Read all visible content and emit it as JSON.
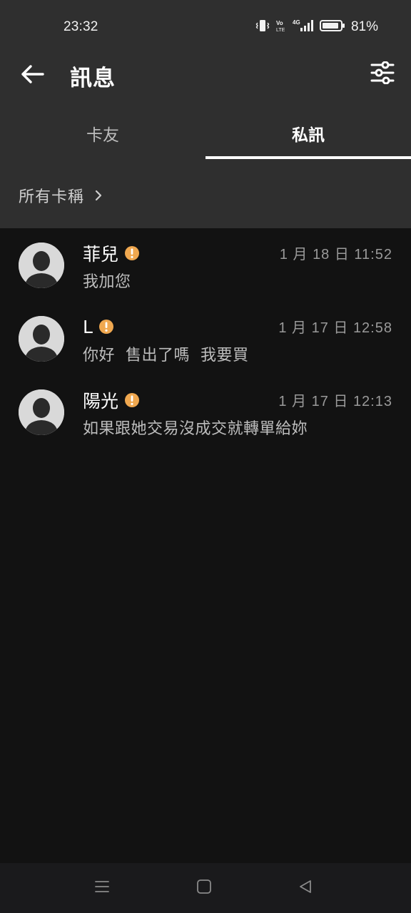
{
  "status_bar": {
    "time": "23:32",
    "battery_percent": "81%",
    "icons": [
      "vibrate-icon",
      "volte-icon",
      "4g-signal-icon",
      "battery-icon"
    ]
  },
  "app_bar": {
    "title": "訊息",
    "back_icon": "arrow-left-icon",
    "filter_icon": "sliders-icon"
  },
  "tabs": [
    {
      "label": "卡友",
      "selected": false
    },
    {
      "label": "私訊",
      "selected": true
    }
  ],
  "filter": {
    "label": "所有卡稱"
  },
  "conversations": [
    {
      "name": "菲兒",
      "time": "1 月 18 日 11:52",
      "message": "我加您",
      "badge": "warning-icon"
    },
    {
      "name": "L",
      "time": "1 月 17 日 12:58",
      "message": "你好  售出了嗎  我要買",
      "badge": "warning-icon"
    },
    {
      "name": "陽光",
      "time": "1 月 17 日 12:13",
      "message": "如果跟她交易沒成交就轉單給妳",
      "badge": "warning-icon"
    }
  ],
  "colors": {
    "header_bg": "#2f2f2f",
    "list_bg": "#121212",
    "warning": "#f0a850",
    "indicator": "#ffffff"
  }
}
